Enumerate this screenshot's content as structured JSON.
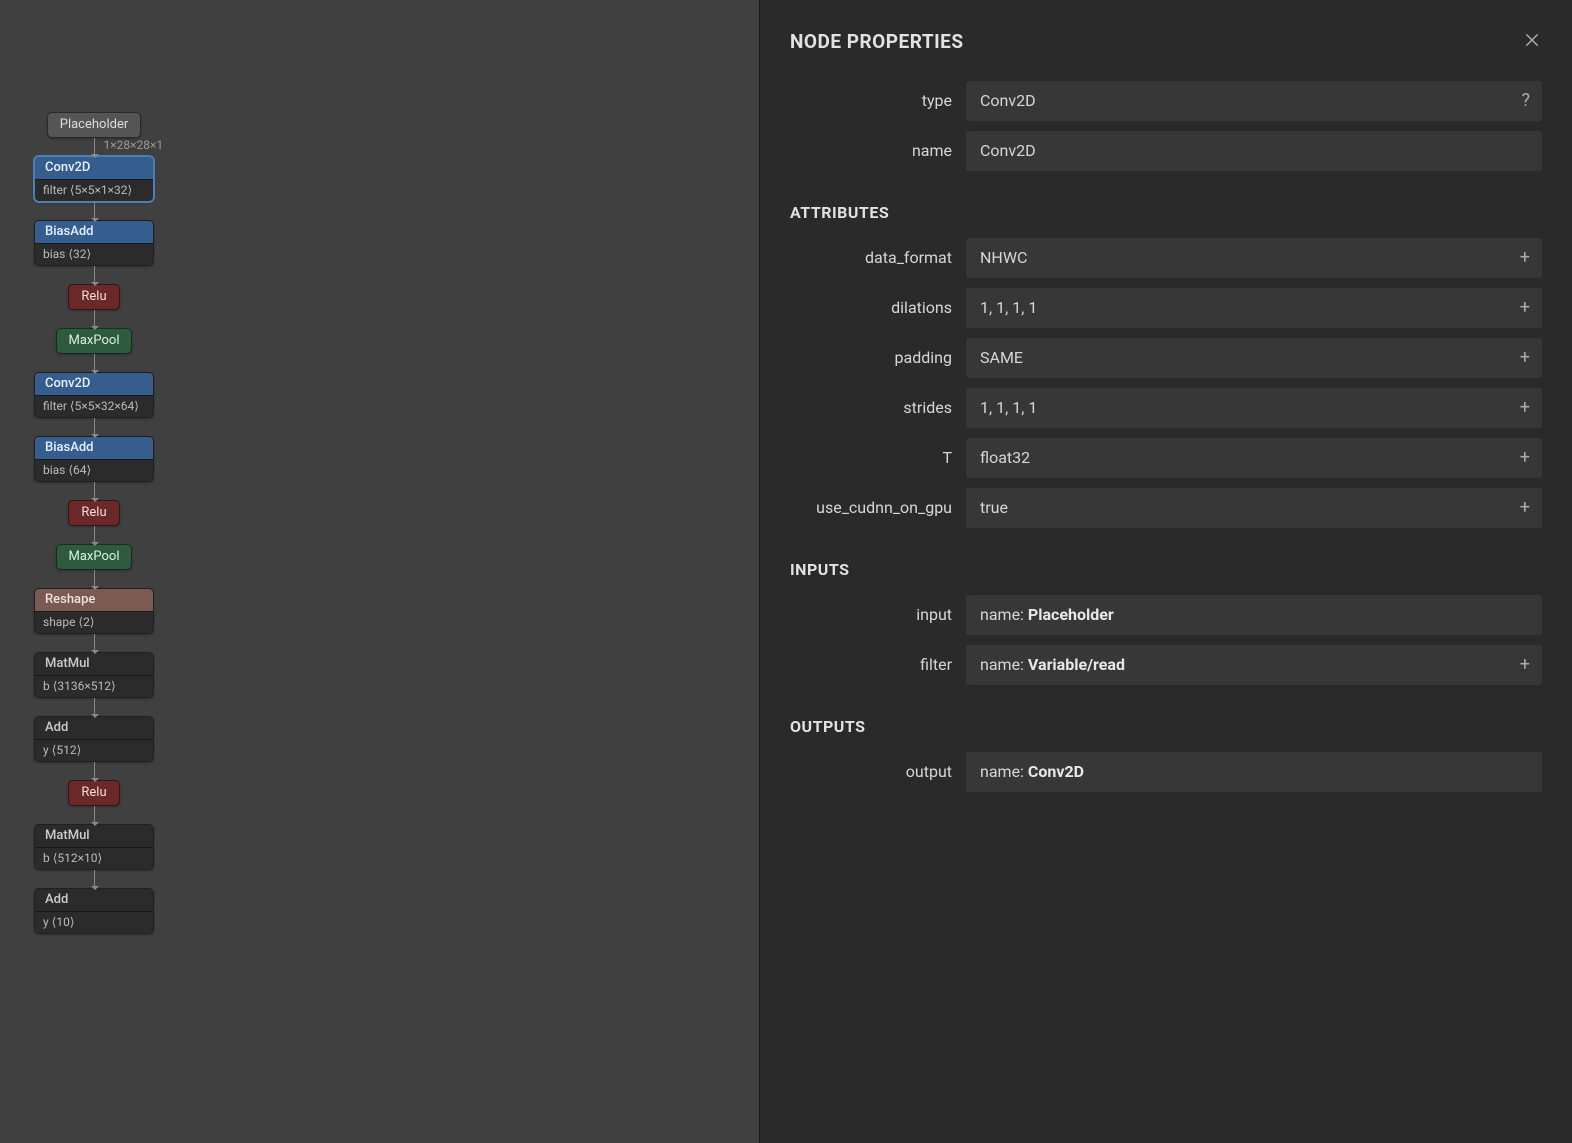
{
  "graph": {
    "placeholder_label": "Placeholder",
    "edge0_label": "1×28×28×1",
    "conv2d1": {
      "title": "Conv2D",
      "sub": "filter ⟨5×5×1×32⟩"
    },
    "biasadd1": {
      "title": "BiasAdd",
      "sub": "bias ⟨32⟩"
    },
    "relu1": "Relu",
    "maxpool1": "MaxPool",
    "conv2d2": {
      "title": "Conv2D",
      "sub": "filter ⟨5×5×32×64⟩"
    },
    "biasadd2": {
      "title": "BiasAdd",
      "sub": "bias ⟨64⟩"
    },
    "relu2": "Relu",
    "maxpool2": "MaxPool",
    "reshape": {
      "title": "Reshape",
      "sub": "shape ⟨2⟩"
    },
    "matmul1": {
      "title": "MatMul",
      "sub": "b ⟨3136×512⟩"
    },
    "add1": {
      "title": "Add",
      "sub": "y ⟨512⟩"
    },
    "relu3": "Relu",
    "matmul2": {
      "title": "MatMul",
      "sub": "b ⟨512×10⟩"
    },
    "add2": {
      "title": "Add",
      "sub": "y ⟨10⟩"
    }
  },
  "panel": {
    "title": "Node Properties",
    "sections": {
      "attributes": "Attributes",
      "inputs": "Inputs",
      "outputs": "Outputs"
    },
    "top": {
      "type_label": "type",
      "type_value": "Conv2D",
      "type_tail": "?",
      "name_label": "name",
      "name_value": "Conv2D"
    },
    "attributes": [
      {
        "label": "data_format",
        "value": "NHWC",
        "tail": "+"
      },
      {
        "label": "dilations",
        "value": "1, 1, 1, 1",
        "tail": "+"
      },
      {
        "label": "padding",
        "value": "SAME",
        "tail": "+"
      },
      {
        "label": "strides",
        "value": "1, 1, 1, 1",
        "tail": "+"
      },
      {
        "label": "T",
        "value": "float32",
        "tail": "+"
      },
      {
        "label": "use_cudnn_on_gpu",
        "value": "true",
        "tail": "+"
      }
    ],
    "inputs": [
      {
        "label": "input",
        "prefix": "name: ",
        "bold": "Placeholder",
        "tail": ""
      },
      {
        "label": "filter",
        "prefix": "name: ",
        "bold": "Variable/read",
        "tail": "+"
      }
    ],
    "outputs": [
      {
        "label": "output",
        "prefix": "name: ",
        "bold": "Conv2D",
        "tail": ""
      }
    ]
  }
}
